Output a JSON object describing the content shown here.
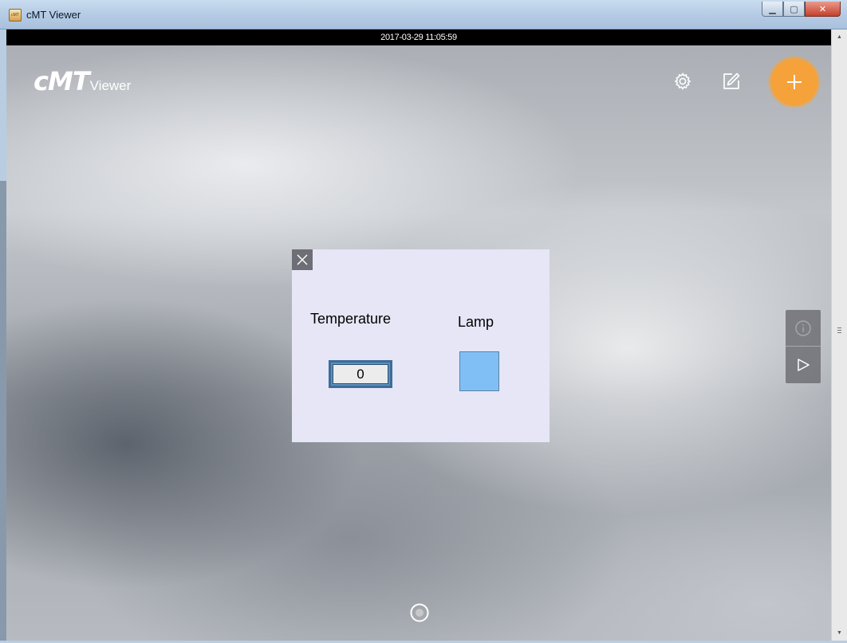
{
  "window": {
    "title": "cMT Viewer",
    "app_icon_text": "cMT",
    "minimize_symbol": "▁",
    "maximize_symbol": "▢",
    "close_symbol": "✕"
  },
  "viewer": {
    "datetime": "2017-03-29 11:05:59",
    "logo_main": "cMT",
    "logo_sub": "Viewer",
    "icons": {
      "settings": "gear-icon",
      "edit": "edit-icon",
      "add": "plus-icon",
      "info": "info-icon",
      "play": "play-icon",
      "home": "home-dot-icon"
    },
    "accent_color": "#f6a23a"
  },
  "dialog": {
    "temperature_label": "Temperature",
    "temperature_value": "0",
    "lamp_label": "Lamp",
    "lamp_color": "#80bff6",
    "background": "#e6e6f7"
  },
  "scrollbar": {
    "up_arrow": "▲",
    "down_arrow": "▼"
  }
}
